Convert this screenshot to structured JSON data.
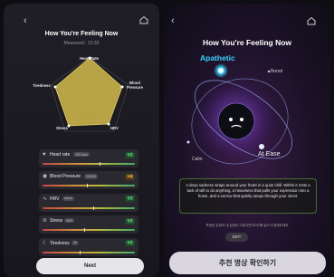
{
  "left": {
    "title": "How You're Feeling Now",
    "measured": "Measured : 12:33",
    "radar_labels": {
      "heart_rate": "Heart Rate",
      "blood_pressure": "Blood\nPressure",
      "hrv": "HRV",
      "stress": "Stress",
      "tiredness": "Tiredness"
    },
    "metrics": [
      {
        "name": "Heart rate",
        "value": "100 bpm",
        "badge": "양호",
        "badge_color": "#48c46b",
        "marker": 0.62
      },
      {
        "name": "Blood Pressure",
        "value": "120/80",
        "badge": "보통",
        "badge_color": "#e9a13a",
        "marker": 0.48
      },
      {
        "name": "HRV",
        "value": "40ms",
        "badge": "양호",
        "badge_color": "#48c46b",
        "marker": 0.55
      },
      {
        "name": "Stress",
        "value": "45%",
        "badge": "양호",
        "badge_color": "#48c46b",
        "marker": 0.45
      },
      {
        "name": "Tiredness",
        "value": "30",
        "badge": "양호",
        "badge_color": "#48c46b",
        "marker": 0.4
      }
    ],
    "next_label": "Next"
  },
  "right": {
    "title": "How You're Feeling Now",
    "emotions": {
      "apathetic": "Apathetic",
      "bored": "Bored",
      "at_ease": "At Ease",
      "calm": "Calm"
    },
    "quote": "A deep sadness wraps around your heart in a quiet chill. Within it rests a lack of will to do anything, a heaviness that pulls your expression into a frown, and a sorrow that quietly seeps through your chest.",
    "note": "측정된 감정과 내 감정이 다르다면 EDIT를 눌러 수정해보세요",
    "edit_label": "EDIT",
    "confirm_label": "추천 명상 확인하기"
  },
  "colors": {
    "accent_cyan": "#39d0ff",
    "radar_fill": "#c9b24a",
    "orbit": "#9fb8ff"
  }
}
